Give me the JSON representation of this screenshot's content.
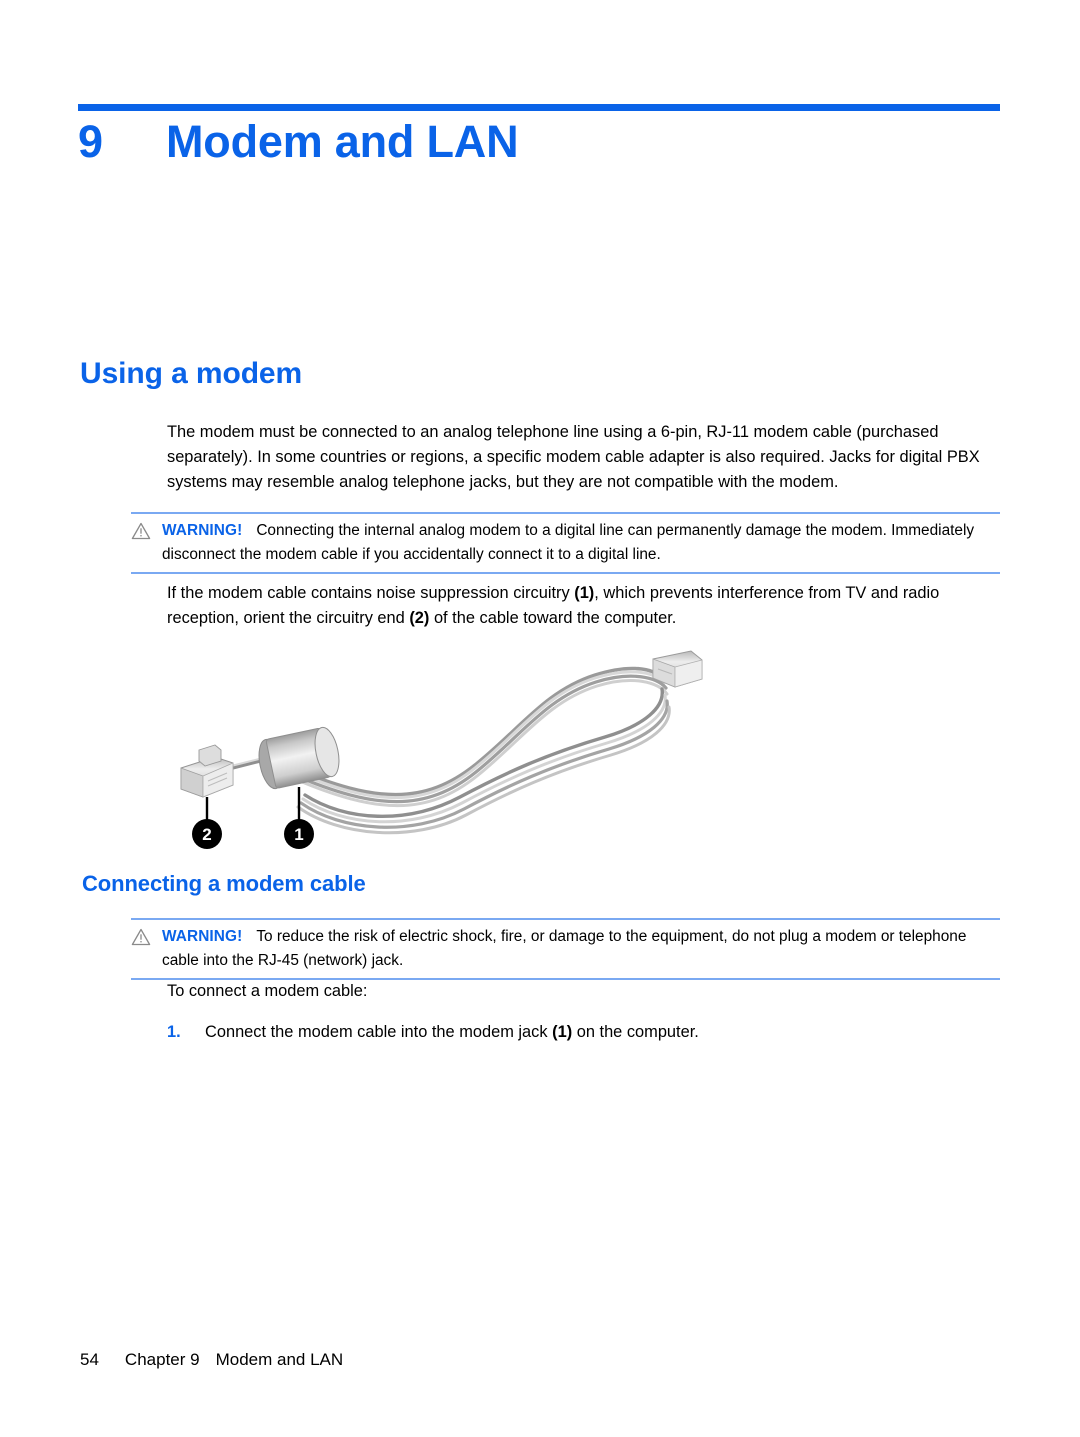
{
  "document": {
    "chapter_number": "9",
    "chapter_title": "Modem and LAN"
  },
  "colors": {
    "accent_blue": "#0a63e8",
    "rule_blue": "#7aa9f2",
    "text_black": "#000000"
  },
  "sections": {
    "heading_1": "Using a modem",
    "heading_2": "Connecting a modem cable"
  },
  "paragraphs": {
    "intro": "The modem must be connected to an analog telephone line using a 6-pin, RJ-11 modem cable (purchased separately). In some countries or regions, a specific modem cable adapter is also required. Jacks for digital PBX systems may resemble analog telephone jacks, but they are not compatible with the modem.",
    "noise_suppression_part1": "If the modem cable contains noise suppression circuitry ",
    "noise_suppression_ref1": "(1)",
    "noise_suppression_part2": ", which prevents interference from TV and radio reception, orient the circuitry end ",
    "noise_suppression_ref2": "(2)",
    "noise_suppression_part3": " of the cable toward the computer.",
    "to_connect": "To connect a modem cable:"
  },
  "warnings": [
    {
      "icon": "warning-triangle-icon",
      "label": "WARNING!",
      "text": "Connecting the internal analog modem to a digital line can permanently damage the modem. Immediately disconnect the modem cable if you accidentally connect it to a digital line."
    },
    {
      "icon": "warning-triangle-icon",
      "label": "WARNING!",
      "text": "To reduce the risk of electric shock, fire, or damage to the equipment, do not plug a modem or telephone cable into the RJ-45 (network) jack."
    }
  ],
  "steps": [
    {
      "number": "1.",
      "text_part1": "Connect the modem cable into the modem jack ",
      "reference": "(1)",
      "text_part2": " on the computer."
    }
  ],
  "figure": {
    "alt": "modem-cable-illustration",
    "callouts": [
      {
        "id": "2",
        "label": "2",
        "describes": "RJ-11 connector end"
      },
      {
        "id": "1",
        "label": "1",
        "describes": "noise suppression circuitry ferrite core"
      }
    ]
  },
  "footer": {
    "page_number": "54",
    "chapter_label": "Chapter 9",
    "chapter_title": "Modem and LAN"
  }
}
